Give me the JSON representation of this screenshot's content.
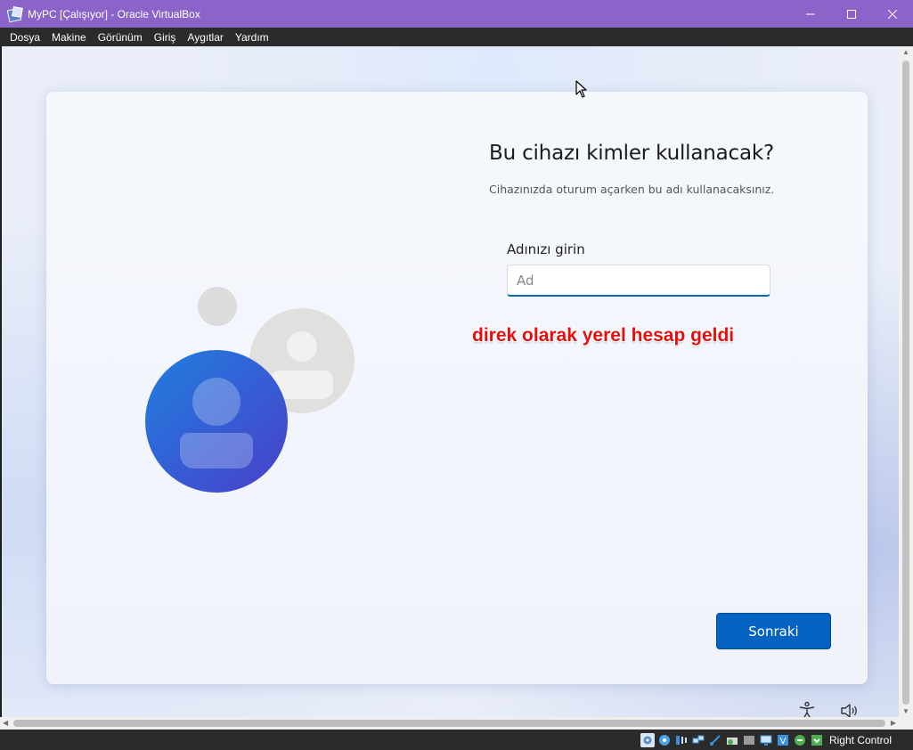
{
  "window": {
    "title": "MyPC [Çalışıyor] - Oracle VirtualBox",
    "minimize_glyph": "—",
    "maximize_glyph": "☐",
    "close_glyph": "✕"
  },
  "menu": [
    "Dosya",
    "Makine",
    "Görünüm",
    "Giriş",
    "Aygıtlar",
    "Yardım"
  ],
  "setup": {
    "heading": "Bu cihazı kimler kullanacak?",
    "subtext": "Cihazınızda oturum açarken bu adı kullanacaksınız.",
    "field_label": "Adınızı girin",
    "name_placeholder": "Ad",
    "name_value": "",
    "next_button": "Sonraki"
  },
  "annotation": "direk olarak yerel hesap geldi",
  "status_bar": {
    "host_key": "Right Control",
    "icons": [
      "hard-disk-icon",
      "optical-drive-icon",
      "audio-icon",
      "network-icon",
      "usb-icon",
      "shared-folders-icon",
      "display-icon",
      "video-capture-icon",
      "virtualization-icon",
      "mouse-integration-icon",
      "keyboard-capture-icon"
    ]
  },
  "colors": {
    "titlebar": "#8b63c9",
    "accent": "#0462c1",
    "annotation": "#e41010"
  }
}
